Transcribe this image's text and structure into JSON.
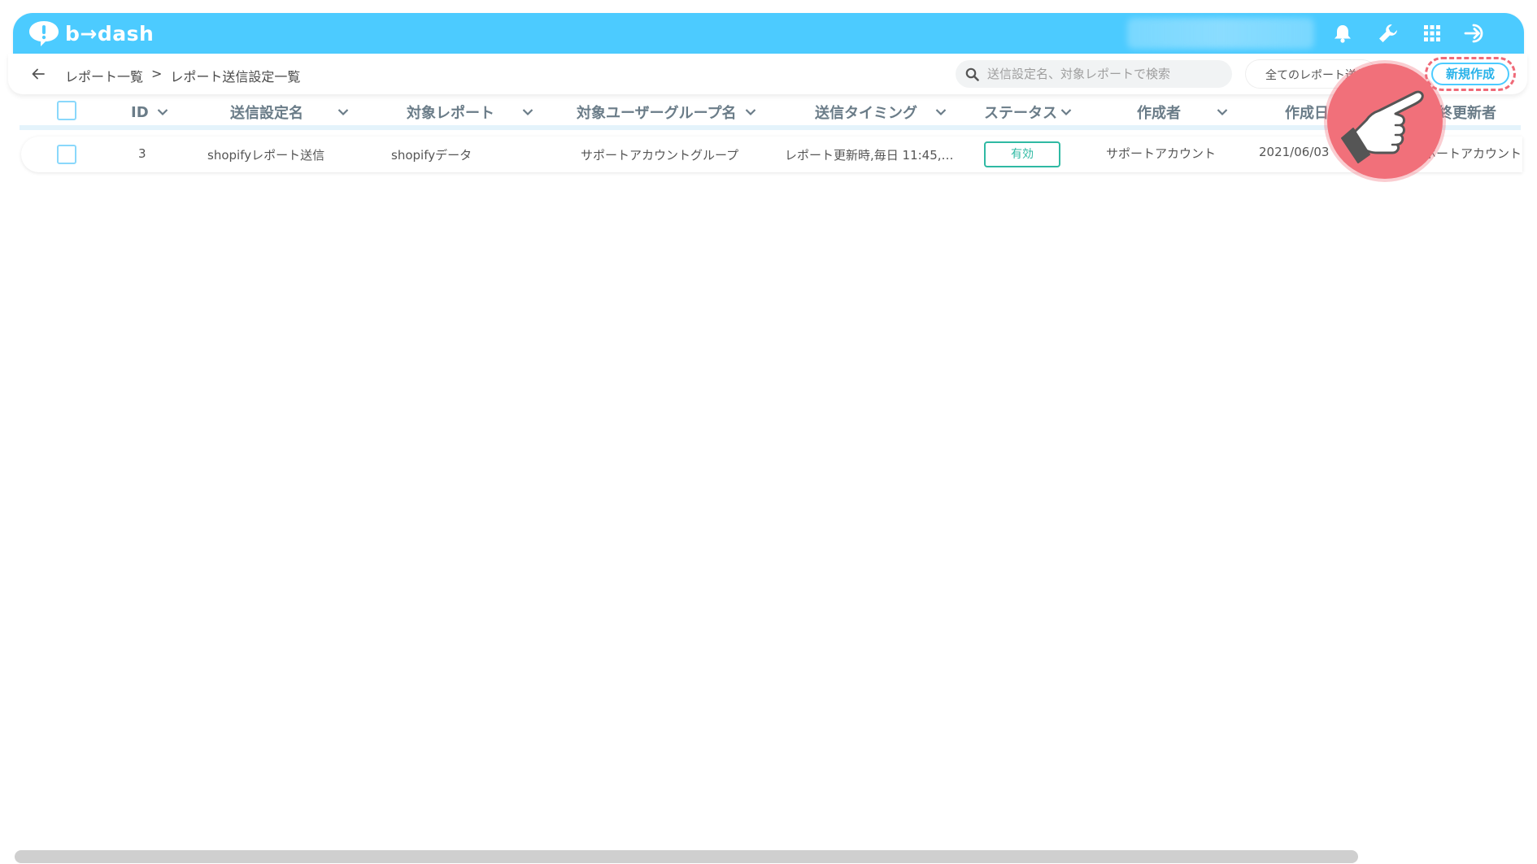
{
  "app": {
    "logo_text": "b→dash"
  },
  "header": {
    "icons": [
      "bell-icon",
      "wrench-icon",
      "apps-grid-icon",
      "logout-icon"
    ]
  },
  "breadcrumb": {
    "parent": "レポート一覧",
    "separator": ">",
    "current": "レポート送信設定一覧"
  },
  "search": {
    "placeholder": "送信設定名、対象レポートで検索",
    "value": ""
  },
  "filter": {
    "selected": "全てのレポート送信"
  },
  "toolbar": {
    "new_label": "新規作成"
  },
  "table": {
    "columns": [
      {
        "key": "id",
        "label": "ID"
      },
      {
        "key": "name",
        "label": "送信設定名"
      },
      {
        "key": "report",
        "label": "対象レポート"
      },
      {
        "key": "group",
        "label": "対象ユーザーグループ名"
      },
      {
        "key": "timing",
        "label": "送信タイミング"
      },
      {
        "key": "status",
        "label": "ステータス"
      },
      {
        "key": "creator",
        "label": "作成者"
      },
      {
        "key": "created",
        "label": "作成日"
      },
      {
        "key": "updater",
        "label": "最終更新者"
      }
    ],
    "rows": [
      {
        "id": "3",
        "name": "shopifyレポート送信",
        "report": "shopifyデータ",
        "group": "サポートアカウントグループ",
        "timing": "レポート更新時,毎日 11:45,…",
        "status": "有効",
        "creator": "サポートアカウント",
        "created": "2021/06/03",
        "updater": "サポートアカウント"
      }
    ]
  },
  "colors": {
    "brand": "#4ccbff",
    "status_active": "#2fb9a3",
    "highlight": "#f1707a"
  }
}
